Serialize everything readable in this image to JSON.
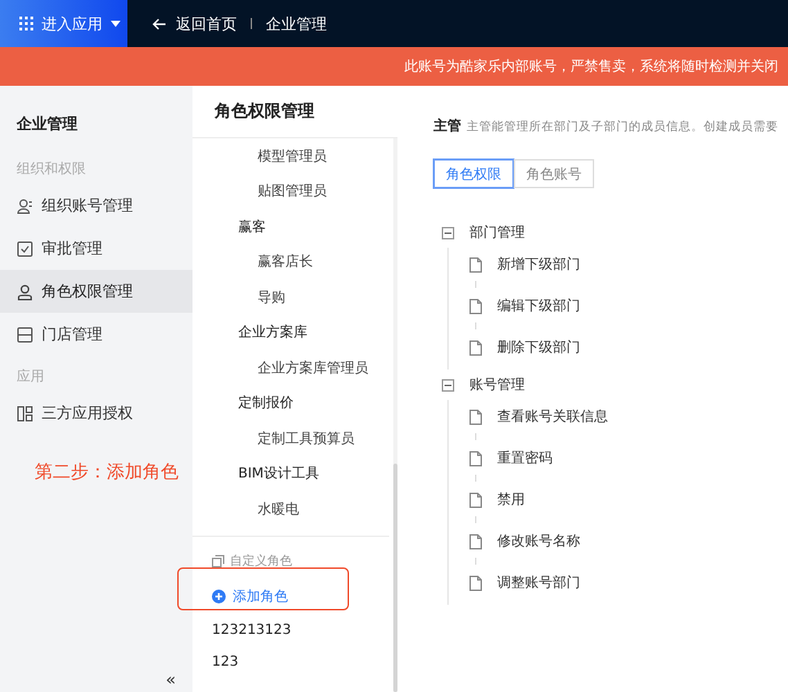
{
  "top_bar": {
    "app_menu": "进入应用",
    "back": "返回首页",
    "page": "企业管理"
  },
  "banner": "此账号为酷家乐内部账号，严禁售卖，系统将随时检测并关闭",
  "sidebar": {
    "title": "企业管理",
    "sections": [
      {
        "label": "组织和权限",
        "items": [
          {
            "label": "组织账号管理",
            "kind": "people",
            "selected": false
          },
          {
            "label": "审批管理",
            "kind": "check",
            "selected": false
          },
          {
            "label": "角色权限管理",
            "kind": "person",
            "selected": true
          },
          {
            "label": "门店管理",
            "kind": "store",
            "selected": false
          }
        ]
      },
      {
        "label": "应用",
        "items": [
          {
            "label": "三方应用授权",
            "kind": "apps",
            "selected": false
          }
        ]
      }
    ],
    "collapse": "«"
  },
  "annotation": "第二步：添加角色",
  "role_panel": {
    "title": "角色权限管理",
    "groups": [
      {
        "children": [
          "模型管理员",
          "贴图管理员"
        ]
      },
      {
        "label": "赢客",
        "children": [
          "赢客店长",
          "导购"
        ]
      },
      {
        "label": "企业方案库",
        "children": [
          "企业方案库管理员"
        ]
      },
      {
        "label": "定制报价",
        "children": [
          "定制工具预算员"
        ]
      },
      {
        "label": "BIM设计工具",
        "children": [
          "水暖电"
        ]
      }
    ],
    "custom": {
      "label": "自定义角色",
      "add_button": {
        "label": "添加角色",
        "highlighted": true
      },
      "roles": [
        "123213123",
        "123"
      ]
    }
  },
  "detail": {
    "role": "主管",
    "description": "主管能管理所在部门及子部门的成员信息。创建成员需要",
    "tabs": [
      {
        "label": "角色权限",
        "selected": true
      },
      {
        "label": "角色账号",
        "selected": false
      }
    ],
    "tree": [
      {
        "label": "部门管理",
        "expanded": true,
        "children": [
          {
            "label": "新增下级部门"
          },
          {
            "label": "编辑下级部门"
          },
          {
            "label": "删除下级部门"
          }
        ]
      },
      {
        "label": "账号管理",
        "expanded": true,
        "children": [
          {
            "label": "查看账号关联信息"
          },
          {
            "label": "重置密码"
          },
          {
            "label": "禁用"
          },
          {
            "label": "修改账号名称"
          },
          {
            "label": "调整账号部门"
          }
        ]
      }
    ]
  }
}
